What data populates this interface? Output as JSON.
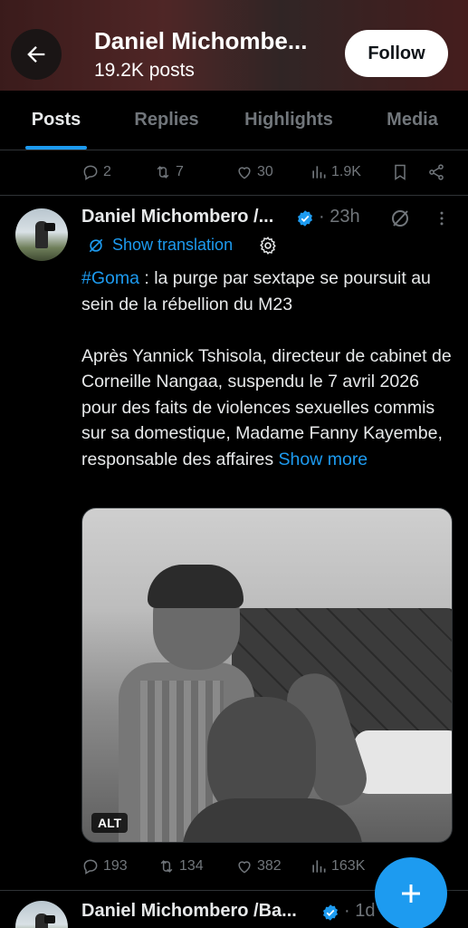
{
  "header": {
    "name": "Daniel Michombe...",
    "posts_count": "19.2K posts",
    "follow_label": "Follow"
  },
  "tabs": [
    {
      "label": "Posts",
      "active": true
    },
    {
      "label": "Replies",
      "active": false
    },
    {
      "label": "Highlights",
      "active": false
    },
    {
      "label": "Media",
      "active": false
    }
  ],
  "prev_post": {
    "replies": "2",
    "reposts": "7",
    "likes": "30",
    "views": "1.9K"
  },
  "post": {
    "author": "Daniel Michombero /...",
    "time": "· 23h",
    "show_translation": "Show translation",
    "hashtag": "#Goma",
    "text_line1": " : la purge par sextape se poursuit au sein de la rébellion du M23",
    "text_para2": "Après Yannick Tshisola, directeur de cabinet de Corneille Nangaa, suspendu le 7 avril 2026 pour des faits de violences sexuelles commis sur sa domestique, Madame Fanny Kayembe, responsable des affaires ",
    "show_more": "Show more",
    "alt_badge": "ALT",
    "replies": "193",
    "reposts": "134",
    "likes": "382",
    "views": "163K"
  },
  "next_post": {
    "author": "Daniel Michombero /Ba...",
    "time": "· 1d"
  },
  "colors": {
    "accent": "#1d9bf0",
    "muted": "#71767b",
    "text": "#e7e9ea",
    "border": "#2f3336"
  }
}
